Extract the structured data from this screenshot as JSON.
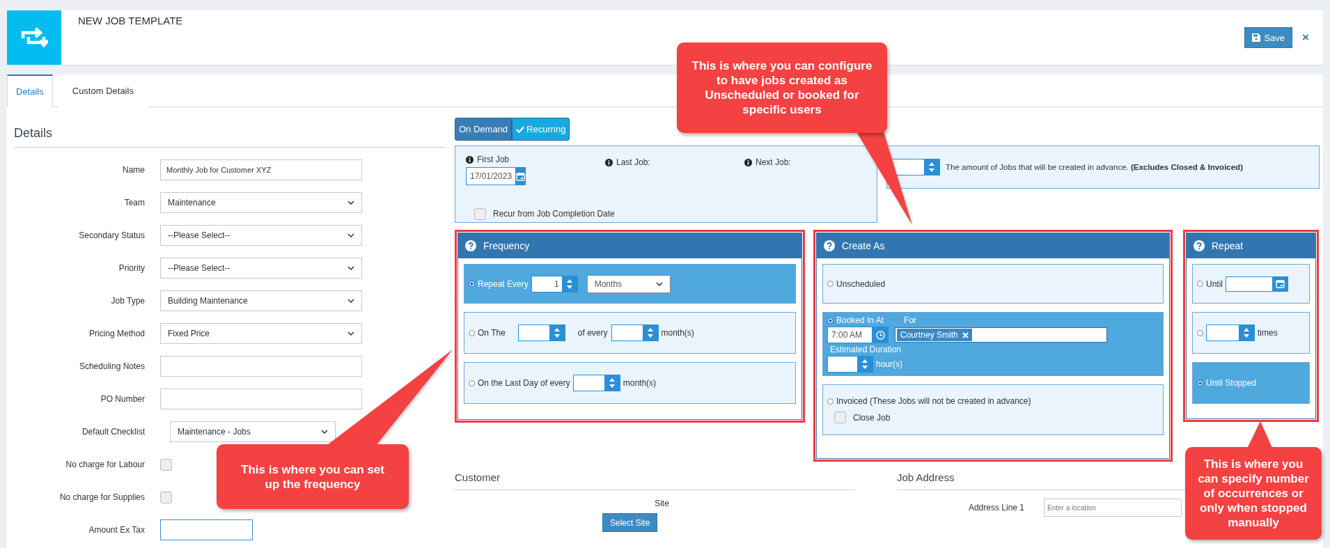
{
  "header": {
    "title": "NEW JOB TEMPLATE",
    "save_label": "Save",
    "close_label": "×"
  },
  "tabs": [
    {
      "label": "Details",
      "selected": true
    },
    {
      "label": "Custom Details",
      "selected": false
    }
  ],
  "details": {
    "heading": "Details",
    "fields": [
      {
        "label": "Name",
        "kind": "text",
        "value": "Monthly Job for Customer XYZ",
        "focused": false
      },
      {
        "label": "Team",
        "kind": "select",
        "value": "Maintenance"
      },
      {
        "label": "Secondary Status",
        "kind": "select",
        "value": "--Please Select--"
      },
      {
        "label": "Priority",
        "kind": "select",
        "value": "--Please Select--"
      },
      {
        "label": "Job Type",
        "kind": "select",
        "value": "Building Maintenance"
      },
      {
        "label": "Pricing Method",
        "kind": "select",
        "value": "Fixed Price"
      },
      {
        "label": "Scheduling Notes",
        "kind": "text",
        "focused": false
      },
      {
        "label": "PO Number",
        "kind": "text",
        "focused": false
      },
      {
        "label": "Default Checklist",
        "kind": "select_short",
        "value": "Maintenance - Jobs"
      },
      {
        "label": "No charge for Labour",
        "kind": "checkbox",
        "checked": false
      },
      {
        "label": "No charge for Supplies",
        "kind": "checkbox",
        "checked": false
      },
      {
        "label": "Amount Ex Tax",
        "kind": "text_short",
        "focused": true
      }
    ]
  },
  "schedule_type": [
    {
      "label": "On Demand",
      "selected": false
    },
    {
      "label": "Recurring",
      "selected": true
    }
  ],
  "dates": {
    "first_job_label": "First Job",
    "first_job_value": "17/01/2023",
    "recur_label": "Recur from Job Completion Date",
    "recur_checked": false,
    "last_job_label": "Last Job:",
    "next_job_label": "Next Job:"
  },
  "advance": {
    "text": "The amount of Jobs that will be created in advance. **(Excludes Closed & Invoiced)**"
  },
  "frequency": {
    "title": "Frequency",
    "options": [
      {
        "kind": "repeat_every",
        "selected": true,
        "label": "Repeat Every",
        "value": "1",
        "unit": "Months"
      },
      {
        "kind": "on_the",
        "selected": false,
        "label": "On The",
        "middle": "of every",
        "suffix": "month(s)"
      },
      {
        "kind": "last_day",
        "selected": false,
        "label": "On the Last Day of every",
        "suffix": "month(s)"
      }
    ]
  },
  "create_as": {
    "title": "Create As",
    "options": [
      {
        "kind": "plain",
        "selected": false,
        "label": "Unscheduled"
      },
      {
        "kind": "booked",
        "selected": true,
        "label": "Booked In At",
        "time": "7:00 AM",
        "for_label": "For",
        "users": [
          "Courtney Smith"
        ],
        "duration_label": "Estimated Duration",
        "duration_unit": "hour(s)"
      },
      {
        "kind": "invoiced",
        "selected": false,
        "label": "Invoiced (These Jobs will not be created in advance)",
        "close_label": "Close Job",
        "close_checked": false
      }
    ]
  },
  "repeat": {
    "title": "Repeat",
    "options": [
      {
        "kind": "until",
        "selected": false,
        "label": "Until"
      },
      {
        "kind": "times",
        "selected": false,
        "label": "times"
      },
      {
        "kind": "plain",
        "selected": true,
        "label": "Until Stopped"
      }
    ]
  },
  "customer": {
    "heading": "Customer",
    "site_label": "Site",
    "button": "Select Site"
  },
  "job_address": {
    "heading": "Job Address",
    "fields": [
      {
        "label": "Address Line 1",
        "placeholder": "Enter a location"
      }
    ]
  },
  "callouts": [
    {
      "text": "This is where you can configure to have jobs created as Unscheduled or booked for specific users"
    },
    {
      "text": "This is where you can set up the frequency"
    },
    {
      "text": "This is where you can specify number of occurrences or only when stopped manually"
    }
  ]
}
